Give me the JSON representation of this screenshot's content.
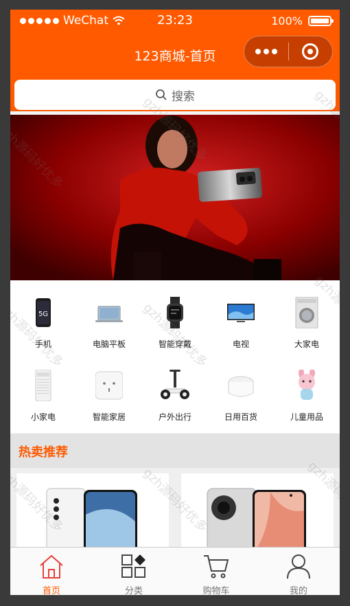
{
  "status_bar": {
    "carrier": "WeChat",
    "time": "23:23",
    "battery": "100%",
    "signal_icon": "signal-dots-icon",
    "wifi_icon": "wifi-icon",
    "battery_icon": "battery-icon"
  },
  "nav": {
    "title": "123商城-首页",
    "more_icon": "more-dots-icon",
    "close_icon": "target-circle-icon"
  },
  "search": {
    "label": "搜索",
    "icon": "search-icon"
  },
  "banner": {
    "image": "phone-promo-banner"
  },
  "categories": [
    {
      "label": "手机",
      "icon": "smartphone-icon"
    },
    {
      "label": "电脑平板",
      "icon": "laptop-icon"
    },
    {
      "label": "智能穿戴",
      "icon": "smartwatch-icon"
    },
    {
      "label": "电视",
      "icon": "tv-icon"
    },
    {
      "label": "大家电",
      "icon": "washing-machine-icon"
    },
    {
      "label": "小家电",
      "icon": "air-purifier-icon"
    },
    {
      "label": "智能家居",
      "icon": "smart-switch-icon"
    },
    {
      "label": "户外出行",
      "icon": "balance-scooter-icon"
    },
    {
      "label": "日用百货",
      "icon": "container-icon"
    },
    {
      "label": "儿童用品",
      "icon": "kids-toy-icon"
    }
  ],
  "hot": {
    "title": "热卖推荐"
  },
  "tabs": [
    {
      "label": "首页",
      "icon": "home-icon",
      "active": true
    },
    {
      "label": "分类",
      "icon": "category-icon",
      "active": false
    },
    {
      "label": "购物车",
      "icon": "cart-icon",
      "active": false
    },
    {
      "label": "我的",
      "icon": "user-icon",
      "active": false
    }
  ],
  "watermark": "gzh源码好优多",
  "colors": {
    "accent": "#ff5a00",
    "nav_capsule": "#c63f00",
    "section_bg": "#e3e3e3"
  }
}
